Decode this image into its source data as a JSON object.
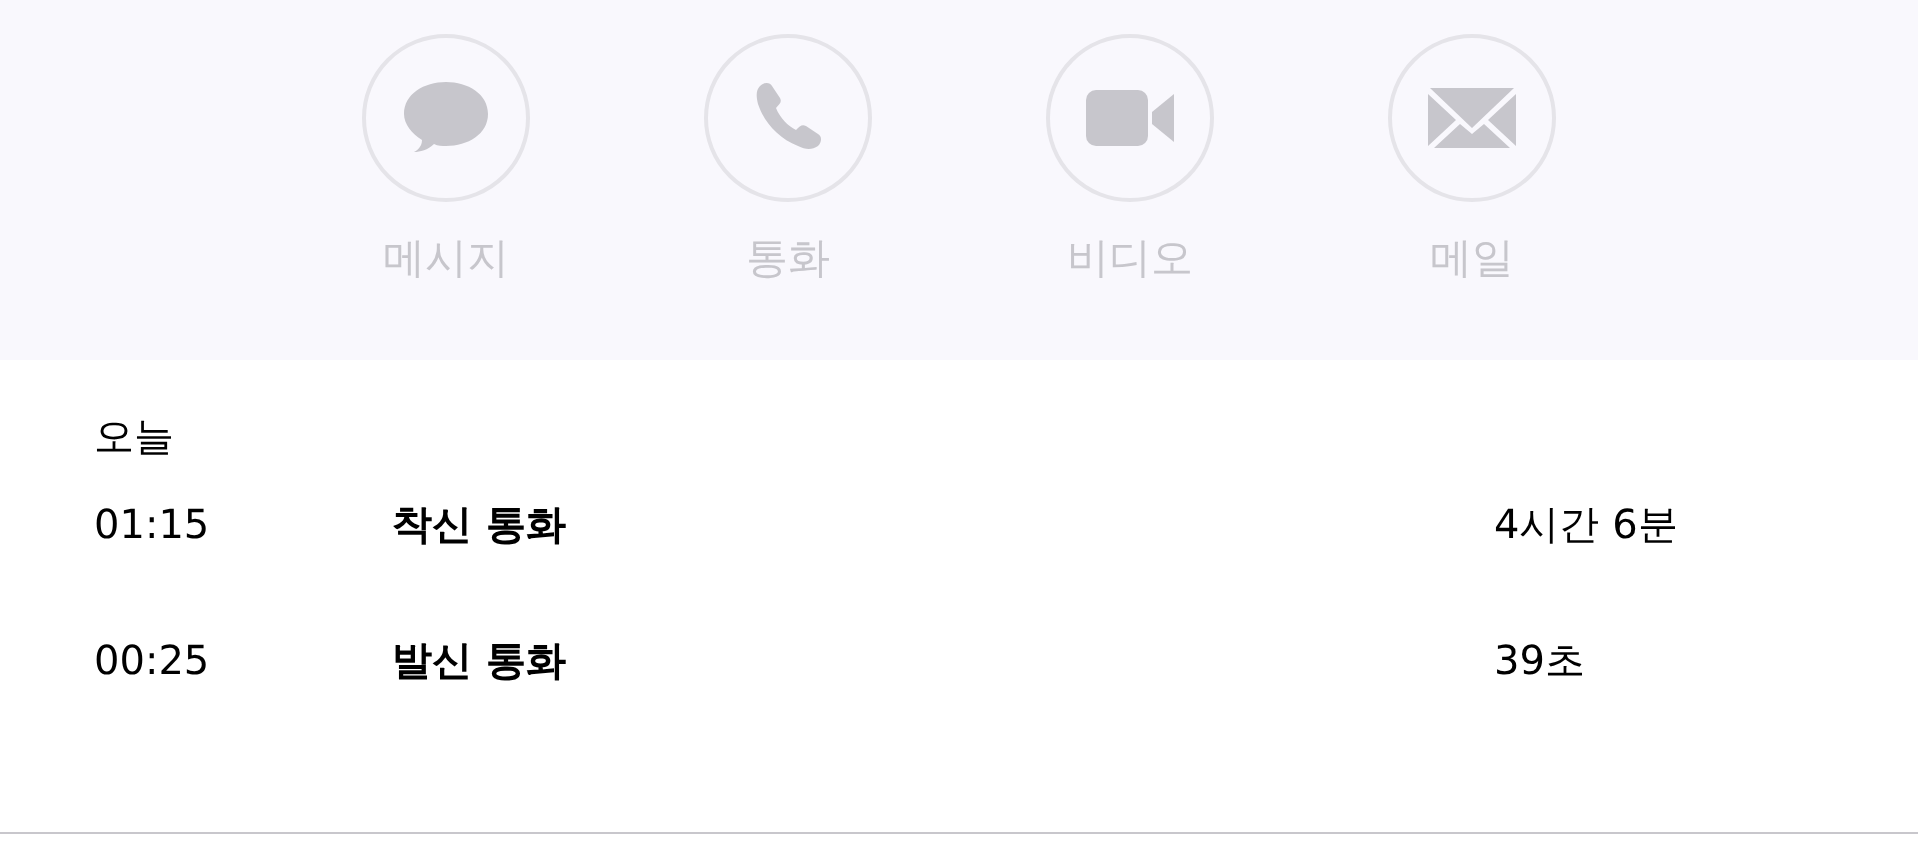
{
  "actions": [
    {
      "kind": "message",
      "label": "메시지",
      "disabled": true
    },
    {
      "kind": "call",
      "label": "통화",
      "disabled": true
    },
    {
      "kind": "video",
      "label": "비디오",
      "disabled": true
    },
    {
      "kind": "mail",
      "label": "메일",
      "disabled": true
    }
  ],
  "history": {
    "heading": "오늘",
    "rows": [
      {
        "time": "01:15",
        "type": "착신 통화",
        "duration": "4시간 6분"
      },
      {
        "time": "00:25",
        "type": "발신 통화",
        "duration": "39초"
      }
    ]
  }
}
